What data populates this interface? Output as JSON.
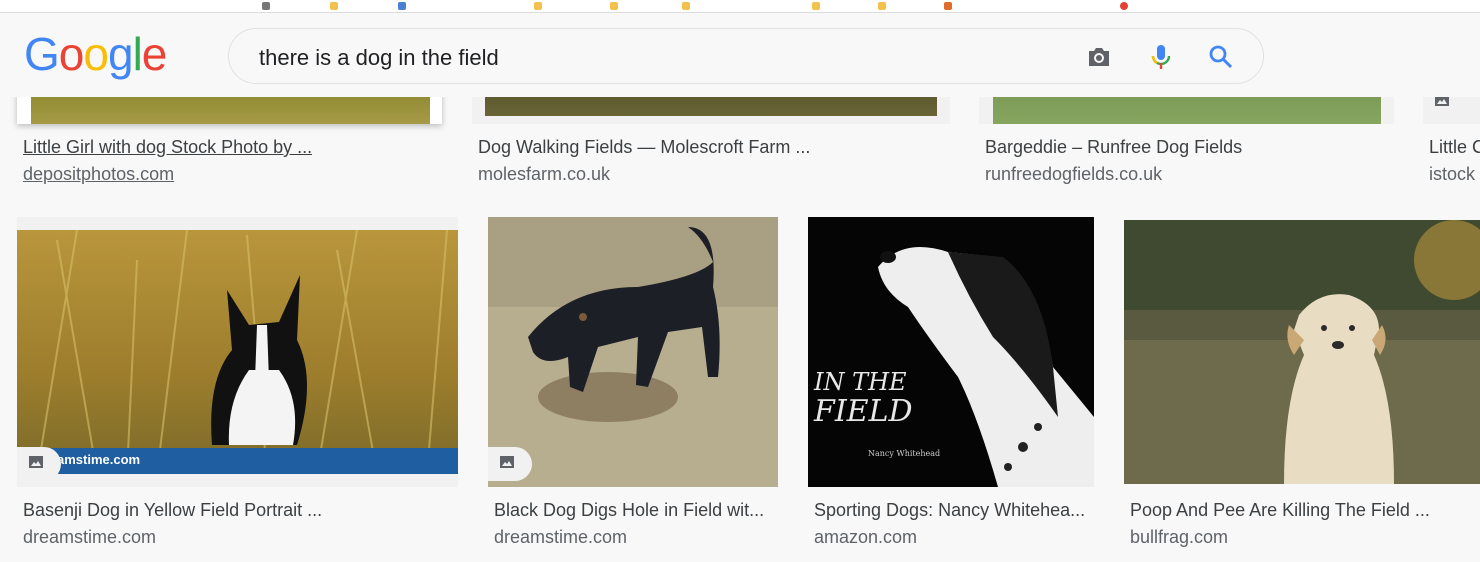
{
  "search": {
    "query": "there is a dog in the field"
  },
  "logo": {
    "letters": [
      "G",
      "o",
      "o",
      "g",
      "l",
      "e"
    ],
    "colors": [
      "#4285f4",
      "#ea4335",
      "#fbbc05",
      "#4285f4",
      "#34a853",
      "#ea4335"
    ]
  },
  "icons": {
    "camera": "camera-icon",
    "mic": "microphone-icon",
    "search": "search-icon",
    "image_badge": "image-icon"
  },
  "results_top": [
    {
      "caption": "Little Girl with dog Stock Photo by ...",
      "source": "depositphotos.com"
    },
    {
      "caption": "Dog Walking Fields — Molescroft Farm ...",
      "source": "molesfarm.co.uk"
    },
    {
      "caption": "Bargeddie – Runfree Dog Fields",
      "source": "runfreedogfields.co.uk"
    },
    {
      "caption": "Little C",
      "source": "istock"
    }
  ],
  "results_bottom": [
    {
      "caption": "Basenji Dog in Yellow Field Portrait ...",
      "source": "dreamstime.com",
      "watermark": "amstime.com"
    },
    {
      "caption": "Black Dog Digs Hole in Field wit...",
      "source": "dreamstime.com"
    },
    {
      "caption": "Sporting Dogs: Nancy Whitehea...",
      "source": "amazon.com",
      "cover_title_line1": "IN THE",
      "cover_title_line2": "FIELD",
      "cover_author": "Nancy Whitehead"
    },
    {
      "caption": "Poop And Pee Are Killing The Field ...",
      "source": "bullfrag.com"
    }
  ]
}
